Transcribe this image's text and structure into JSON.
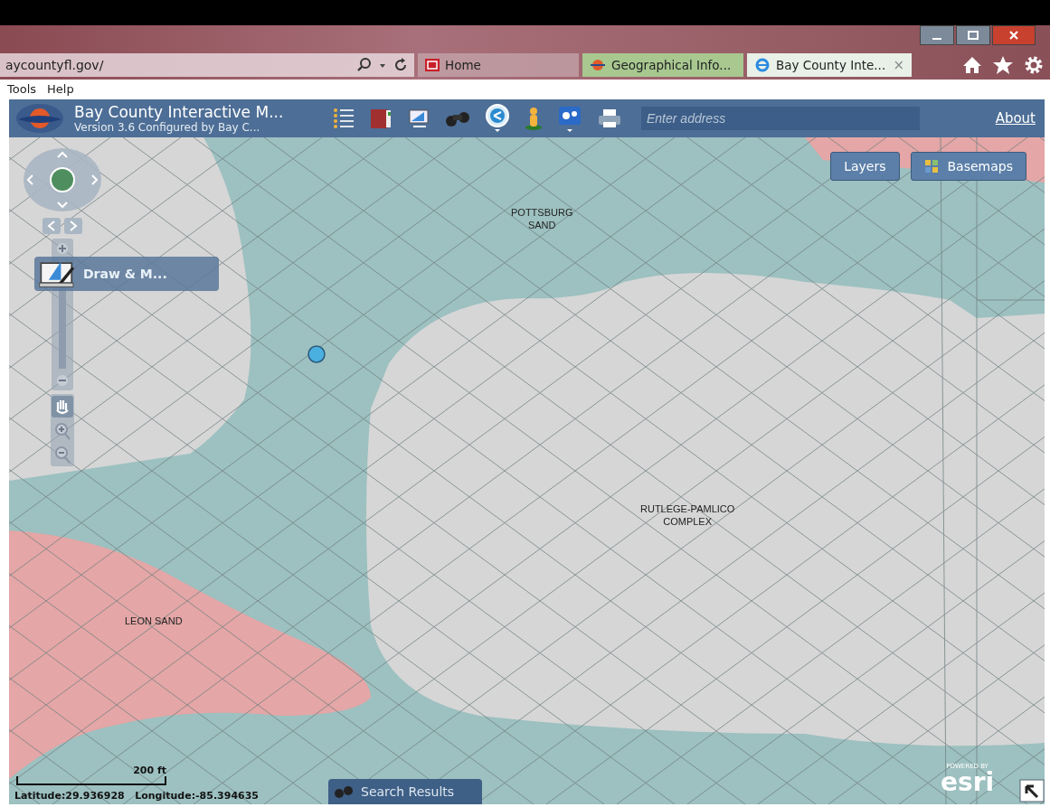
{
  "browser": {
    "address": "aycountyfl.gov/",
    "tabs": [
      {
        "label": "Home",
        "selected": false,
        "kind": "home"
      },
      {
        "label": "Geographical Info...",
        "selected": false,
        "kind": "geo"
      },
      {
        "label": "Bay County Inte...",
        "selected": true,
        "kind": "ie",
        "close": "×"
      }
    ],
    "menu": [
      "Tools",
      "Help"
    ]
  },
  "app": {
    "title": "Bay County Interactive M...",
    "subtitle": "Version 3.6 Configured by Bay C...",
    "search": {
      "placeholder": "Enter address"
    },
    "about": "About"
  },
  "map": {
    "buttons": [
      {
        "label": "Layers",
        "kind": "plain"
      },
      {
        "label": "Basemaps",
        "kind": "grid"
      }
    ],
    "draw_panel": "Draw & M...",
    "zoom_slider": {
      "level": 0.9
    },
    "labels": [
      {
        "lines": [
          "POTTSBURG",
          "SAND"
        ],
        "kind": "top"
      },
      {
        "lines": [
          "RUTLEGE-PAMLICO",
          "COMPLEX"
        ],
        "kind": "center"
      },
      {
        "lines": [
          "LEON SAND"
        ],
        "kind": "left"
      }
    ],
    "scale": "200 ft",
    "coordinates": "Latitude:29.936928   Longitude:-85.394635",
    "search_results": "Search Results",
    "esri_powered": "POWERED BY",
    "esri": "esri"
  }
}
